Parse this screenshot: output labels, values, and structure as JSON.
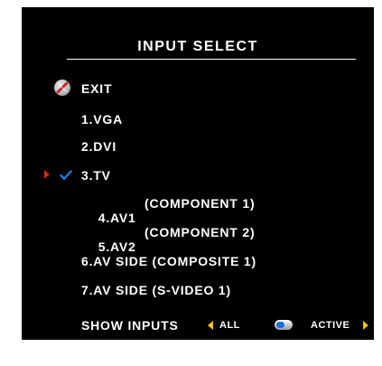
{
  "menu": {
    "title": "INPUT SELECT",
    "exit_label": "EXIT",
    "items": [
      {
        "label": "1.VGA"
      },
      {
        "label": "2.DVI"
      },
      {
        "label": "3.TV",
        "selected": true
      },
      {
        "label": "4.AV1",
        "detail": "(COMPONENT 1)"
      },
      {
        "label": "5.AV2",
        "detail": "(COMPONENT 2)"
      },
      {
        "label": "6.AV SIDE (COMPOSITE 1)"
      },
      {
        "label": "7.AV SIDE (S-VIDEO 1)"
      }
    ],
    "show_inputs": {
      "label": "SHOW INPUTS",
      "option_left": "ALL",
      "option_right": "ACTIVE"
    }
  },
  "colors": {
    "background": "#000000",
    "text": "#ffffff",
    "pointer": "#d2261a",
    "checkmark": "#1e7be6",
    "arrows": "#f2c21a",
    "toggle_knob": "#1e6fe0"
  },
  "icons": {
    "exit": "exit-icon",
    "pointer": "red-triangle-pointer-icon",
    "check": "checkmark-icon"
  }
}
